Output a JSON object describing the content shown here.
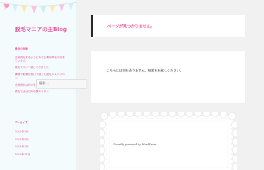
{
  "site": {
    "title": "脱毛マニアの主Blog",
    "accent_color": "#e8589b"
  },
  "sidebar": {
    "recent_title": "最近の投稿",
    "recent_posts": [
      "全身脱毛するようになり仕事効率化が出来ています。",
      "脱毛サロン一度してきました",
      "構想や影響を受けて通った脱毛エステサロン",
      "全身脱毛は何人を通りこえる要望？",
      "脱毛ではは方向の関のサロン"
    ],
    "archive_title": "アーカイブ",
    "archives": [
      "2015年3月",
      "2015年2月",
      "2015年1月",
      "2014年12月"
    ]
  },
  "main": {
    "not_found_title": "ページが見つかりません。",
    "not_found_message": "こちらには何もありません。検索をお試しください。",
    "search_placeholder": "検索 …"
  },
  "footer": {
    "credit": "Proudly powered by WordPress"
  }
}
